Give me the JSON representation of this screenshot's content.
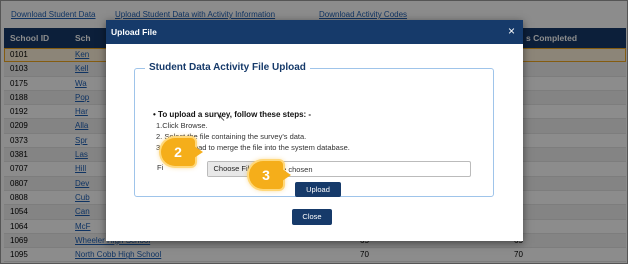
{
  "top_links": [
    "Download Student Data",
    "Upload Student Data with Activity Information",
    "Download Activity Codes"
  ],
  "grid": {
    "headers": [
      "School ID",
      "Sch",
      "s Completed"
    ],
    "rows": [
      {
        "id": "0101",
        "name": "Ken",
        "v1": "",
        "v2": ""
      },
      {
        "id": "0103",
        "name": "Kell",
        "v1": "",
        "v2": ""
      },
      {
        "id": "0175",
        "name": "Wa",
        "v1": "",
        "v2": ""
      },
      {
        "id": "0188",
        "name": "Pop",
        "v1": "",
        "v2": ""
      },
      {
        "id": "0192",
        "name": "Har",
        "v1": "",
        "v2": ""
      },
      {
        "id": "0209",
        "name": "Alla",
        "v1": "",
        "v2": ""
      },
      {
        "id": "0373",
        "name": "Spr",
        "v1": "",
        "v2": ""
      },
      {
        "id": "0381",
        "name": "Las",
        "v1": "",
        "v2": ""
      },
      {
        "id": "0707",
        "name": "Hill",
        "v1": "",
        "v2": ""
      },
      {
        "id": "0807",
        "name": "Dev",
        "v1": "",
        "v2": ""
      },
      {
        "id": "0808",
        "name": "Cub",
        "v1": "",
        "v2": ""
      },
      {
        "id": "1054",
        "name": "Can",
        "v1": "",
        "v2": ""
      },
      {
        "id": "1064",
        "name": "McF",
        "v1": "",
        "v2": ""
      },
      {
        "id": "1069",
        "name": "Wheeler High School",
        "v1": "65",
        "v2": "65"
      },
      {
        "id": "1095",
        "name": "North Cobb High School",
        "v1": "70",
        "v2": "70"
      }
    ]
  },
  "modal": {
    "title": "Upload File",
    "close_icon": "×",
    "legend": "Student Data Activity File Upload",
    "instructions_title": "• To upload a survey, follow these steps: -",
    "steps": [
      "1.Click Browse.",
      "2. Select the file containing the survey's data.",
      "3. Click Upload to merge the file into the system database."
    ],
    "file_label": "Fi",
    "choose_file": "Choose File",
    "no_file": "No file chosen",
    "upload": "Upload",
    "close": "Close"
  },
  "callouts": [
    "2",
    "3"
  ],
  "colors": {
    "header": "#163a6a",
    "link": "#1e5fb4",
    "callout": "#f5ae1a"
  }
}
